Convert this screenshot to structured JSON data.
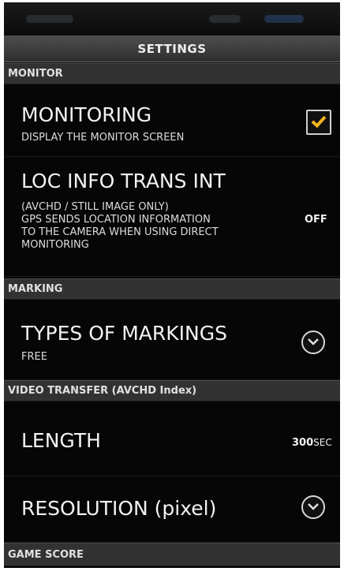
{
  "header": {
    "title": "SETTINGS"
  },
  "sections": [
    {
      "label": "MONITOR"
    },
    {
      "label": "MARKING"
    },
    {
      "label": "VIDEO TRANSFER (AVCHD Index)"
    },
    {
      "label": "GAME SCORE"
    }
  ],
  "rows": {
    "monitoring": {
      "title": "MONITORING",
      "subtitle": "DISPLAY THE MONITOR SCREEN",
      "checked": true
    },
    "loc_info": {
      "title": "LOC INFO TRANS INT",
      "subtitle": "(AVCHD / STILL IMAGE ONLY)\nGPS SENDS LOCATION INFORMATION\nTO THE CAMERA WHEN USING DIRECT\nMONITORING",
      "value": "OFF"
    },
    "markings": {
      "title": "TYPES OF MARKINGS",
      "subtitle": "FREE"
    },
    "length": {
      "title": "LENGTH",
      "value": "300",
      "unit": "SEC"
    },
    "resolution": {
      "title": "RESOLUTION (pixel)"
    }
  },
  "colors": {
    "accent_check": "#f2b51b",
    "background": "#050505",
    "section_bg": "#323232"
  },
  "icons": {
    "checkbox": "checkbox-checked-icon",
    "dropdown": "chevron-down-circle-icon"
  }
}
